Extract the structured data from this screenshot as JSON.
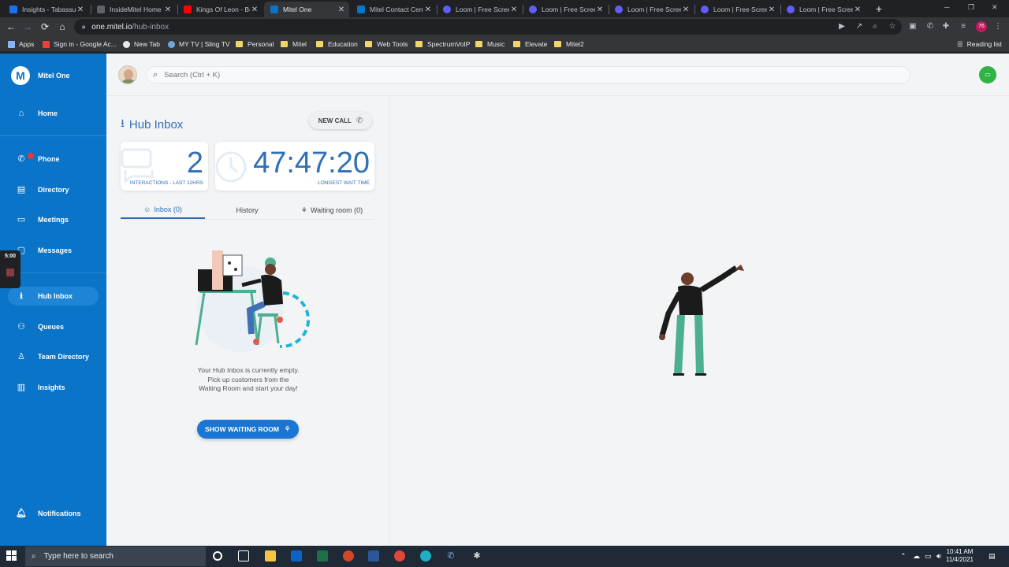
{
  "browser": {
    "tabs": [
      {
        "title": "Insights - Tabassum",
        "favicon_color": "#1a73e8"
      },
      {
        "title": "InsideMitel Home",
        "favicon_color": "#5f6368"
      },
      {
        "title": "Kings Of Leon - Be",
        "favicon_color": "#ff0000"
      },
      {
        "title": "Mitel One",
        "favicon_color": "#0a74c9",
        "active": true
      },
      {
        "title": "Mitel Contact Cent",
        "favicon_color": "#0a74c9"
      },
      {
        "title": "Loom | Free Screen",
        "favicon_color": "#625df5"
      },
      {
        "title": "Loom | Free Screen",
        "favicon_color": "#625df5"
      },
      {
        "title": "Loom | Free Screen",
        "favicon_color": "#625df5"
      },
      {
        "title": "Loom | Free Screen",
        "favicon_color": "#625df5"
      },
      {
        "title": "Loom | Free Screen",
        "favicon_color": "#625df5"
      }
    ],
    "url_host": "one.mitel.io",
    "url_path": "/hub-inbox",
    "profile_badge": "76",
    "reading_list": "Reading list",
    "bookmarks": [
      {
        "label": "Apps",
        "type": "apps"
      },
      {
        "label": "Sign in - Google Ac...",
        "type": "gmail"
      },
      {
        "label": "New Tab",
        "type": "site"
      },
      {
        "label": "MY TV | Sling TV",
        "type": "sling"
      },
      {
        "label": "Personal",
        "type": "folder"
      },
      {
        "label": "Mitel",
        "type": "folder"
      },
      {
        "label": "Education",
        "type": "folder"
      },
      {
        "label": "Web Tools",
        "type": "folder"
      },
      {
        "label": "SpectrumVoIP",
        "type": "folder"
      },
      {
        "label": "Music",
        "type": "folder"
      },
      {
        "label": "Elevate",
        "type": "folder"
      },
      {
        "label": "Mitel2",
        "type": "folder"
      }
    ]
  },
  "app": {
    "brand": "Mitel One",
    "sidebar": [
      {
        "label": "Home",
        "icon": "home-icon"
      },
      {
        "label": "Phone",
        "icon": "phone-icon"
      },
      {
        "label": "Directory",
        "icon": "directory-icon"
      },
      {
        "label": "Meetings",
        "icon": "meetings-icon"
      },
      {
        "label": "Messages",
        "icon": "messages-icon"
      },
      {
        "label": "Hub Inbox",
        "icon": "hub-inbox-icon",
        "active": true
      },
      {
        "label": "Queues",
        "icon": "queues-icon"
      },
      {
        "label": "Team Directory",
        "icon": "team-directory-icon"
      },
      {
        "label": "Insights",
        "icon": "insights-icon"
      },
      {
        "label": "Notifications",
        "icon": "bell-icon"
      }
    ],
    "search_placeholder": "Search (Ctrl + K)",
    "hub_inbox": {
      "title": "Hub Inbox",
      "new_call": "NEW CALL",
      "interactions_value": "2",
      "interactions_label": "INTERACTIONS - LAST 12HRS",
      "wait_value": "47:47:20",
      "wait_label": "LONGEST WAIT TIME",
      "tabs": [
        "Inbox (0)",
        "History",
        "Waiting room (0)"
      ],
      "empty_lines": [
        "Your Hub Inbox is currently empty.",
        "Pick up customers from the",
        "Waiting Room and start your day!"
      ],
      "show_waiting_room": "SHOW WAITING ROOM"
    }
  },
  "loom": {
    "timer": "5:00"
  },
  "taskbar": {
    "search_placeholder": "Type here to search",
    "time": "10:41 AM",
    "date": "11/4/2021"
  },
  "colors": {
    "sidebar": "#0a74c9",
    "accent": "#2f6fb7",
    "status_green": "#2fb344",
    "cta": "#1976d2"
  }
}
